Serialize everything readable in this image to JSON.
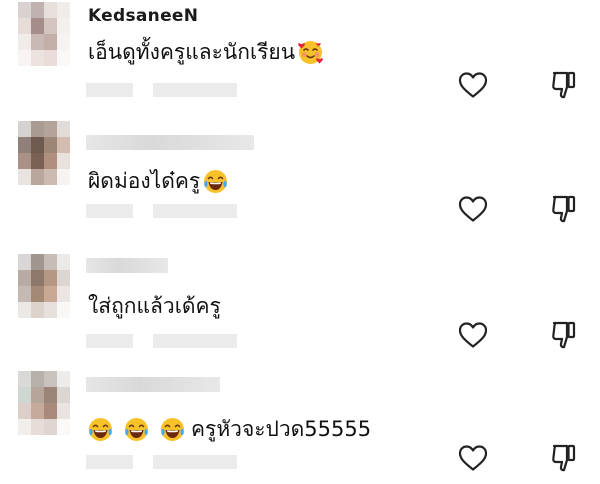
{
  "comments": [
    {
      "username": "KedsaneeN",
      "text": "เอ็นดูทั้งครูและนักเรียน",
      "emoji_after": "smiling-face-with-hearts"
    },
    {
      "username": "",
      "text": "ผิดม่องได๋ครู",
      "emoji_after": "face-with-tears-of-joy"
    },
    {
      "username": "",
      "text": "ใส่ถูกแล้วเด้ครู",
      "emoji_after": ""
    },
    {
      "username": "",
      "text": "ครูหัวจะปวด55555",
      "emoji_before": [
        "face-with-tears-of-joy",
        "face-with-tears-of-joy",
        "face-with-tears-of-joy"
      ]
    }
  ],
  "icons": {
    "like": "heart-outline-icon",
    "dislike": "thumbs-down-outline-icon"
  },
  "colors": {
    "icon_stroke": "#222222",
    "blur": "#e2e2e2"
  }
}
